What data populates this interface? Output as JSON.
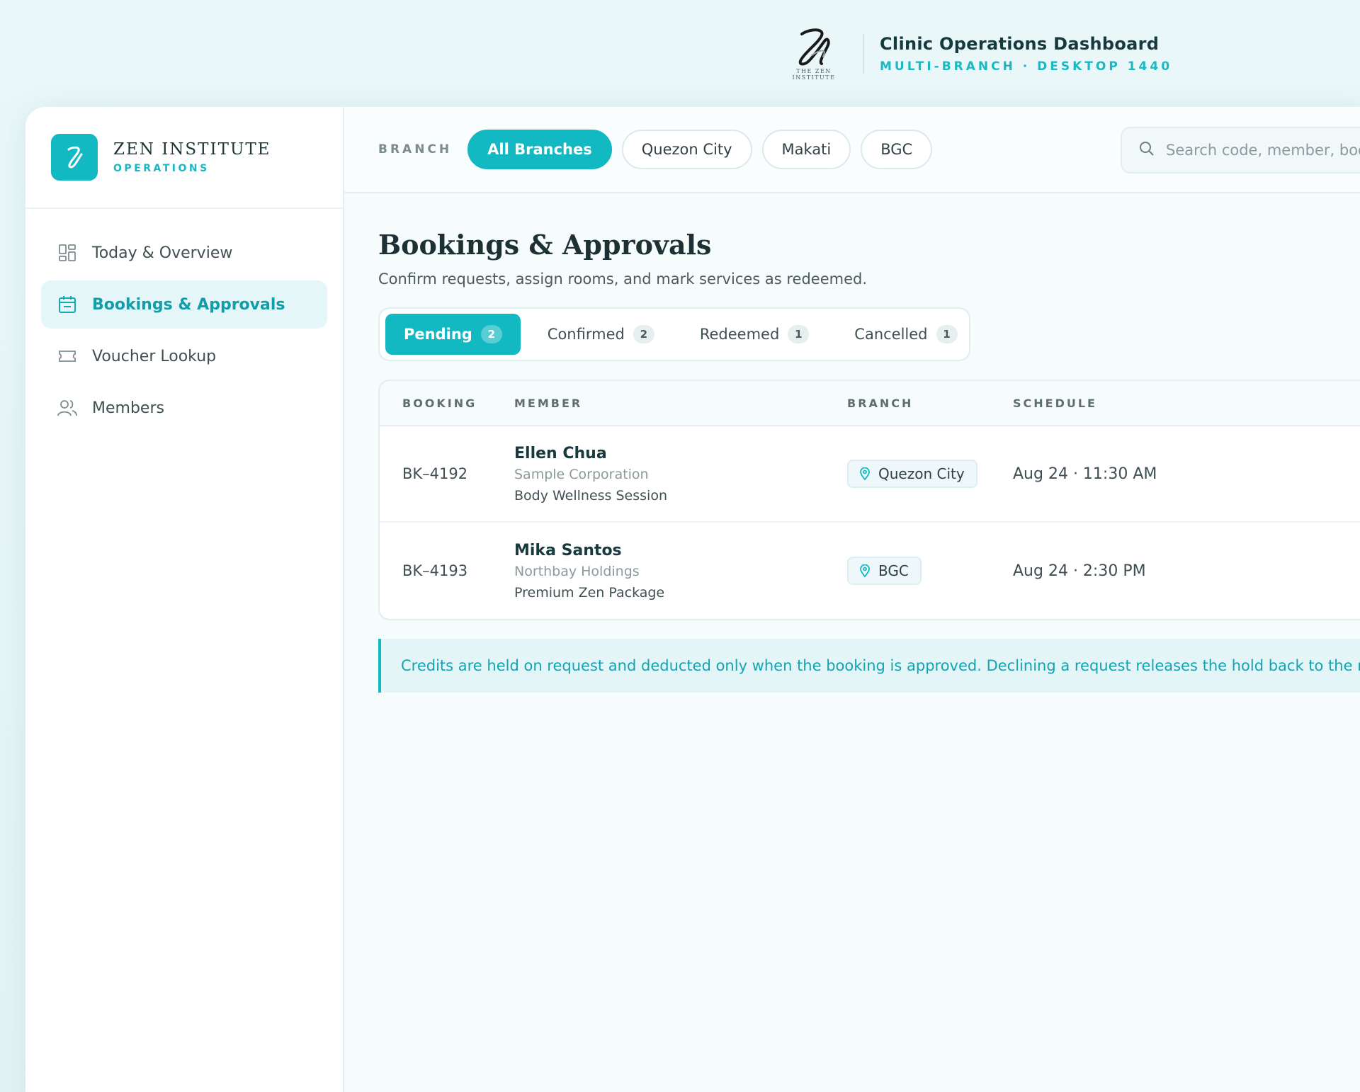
{
  "header": {
    "logo_caption": "THE ZEN INSTITUTE",
    "title": "Clinic Operations Dashboard",
    "subtitle": "MULTI-BRANCH · DESKTOP 1440"
  },
  "sidebar": {
    "brand_name": "ZEN INSTITUTE",
    "brand_sub": "OPERATIONS",
    "items": [
      {
        "label": "Today & Overview",
        "icon": "dashboard-icon",
        "active": false
      },
      {
        "label": "Bookings & Approvals",
        "icon": "calendar-icon",
        "active": true
      },
      {
        "label": "Voucher Lookup",
        "icon": "ticket-icon",
        "active": false
      },
      {
        "label": "Members",
        "icon": "users-icon",
        "active": false
      }
    ]
  },
  "filters": {
    "label": "BRANCH",
    "chips": [
      "All Branches",
      "Quezon City",
      "Makati",
      "BGC"
    ],
    "active_chip": "All Branches"
  },
  "search": {
    "placeholder": "Search code, member, booking"
  },
  "page": {
    "title": "Bookings & Approvals",
    "subtitle": "Confirm requests, assign rooms, and mark services as redeemed."
  },
  "tabs": [
    {
      "label": "Pending",
      "count": "2",
      "active": true
    },
    {
      "label": "Confirmed",
      "count": "2",
      "active": false
    },
    {
      "label": "Redeemed",
      "count": "1",
      "active": false
    },
    {
      "label": "Cancelled",
      "count": "1",
      "active": false
    }
  ],
  "table": {
    "columns": [
      "BOOKING",
      "MEMBER",
      "BRANCH",
      "SCHEDULE"
    ],
    "rows": [
      {
        "code": "BK–4192",
        "member": "Ellen Chua",
        "company": "Sample Corporation",
        "service": "Body Wellness Session",
        "branch": "Quezon City",
        "schedule": "Aug 24 · 11:30 AM"
      },
      {
        "code": "BK–4193",
        "member": "Mika Santos",
        "company": "Northbay Holdings",
        "service": "Premium Zen Package",
        "branch": "BGC",
        "schedule": "Aug 24 · 2:30 PM"
      }
    ]
  },
  "notice": "Credits are held on request and deducted only when the booking is approved. Declining a request releases the hold back to the member.",
  "colors": {
    "accent": "#12b8c2",
    "accent_text": "#14a3b0",
    "heading": "#153a3e"
  }
}
